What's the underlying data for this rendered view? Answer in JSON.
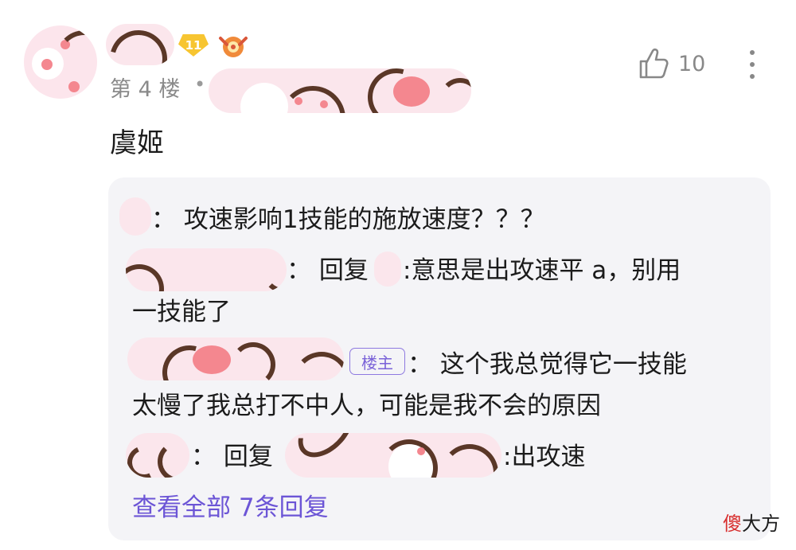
{
  "post": {
    "level": "11",
    "floor": "第 4 楼",
    "separator": "•",
    "likes": "10",
    "comment": "虞姬"
  },
  "replies": [
    {
      "text": "： 攻速影响1技能的施放速度？？？"
    },
    {
      "prefix": "： 回复",
      "text": ":意思是出攻速平 a，别用"
    },
    {
      "text": "一技能了"
    },
    {
      "tag": "楼主",
      "text": "： 这个我总觉得它一技能"
    },
    {
      "text": "太慢了我总打不中人，可能是我不会的原因"
    },
    {
      "prefix": "： 回复",
      "text": ":出攻速"
    }
  ],
  "view_all": "查看全部 7条回复",
  "watermark": {
    "first": "傻",
    "rest": "大方"
  },
  "colors": {
    "accent": "#6c55d6",
    "badge": "#f7c531",
    "mask": "#fbe6ec"
  },
  "icons": [
    "like-icon",
    "more-icon",
    "medal-icon"
  ]
}
